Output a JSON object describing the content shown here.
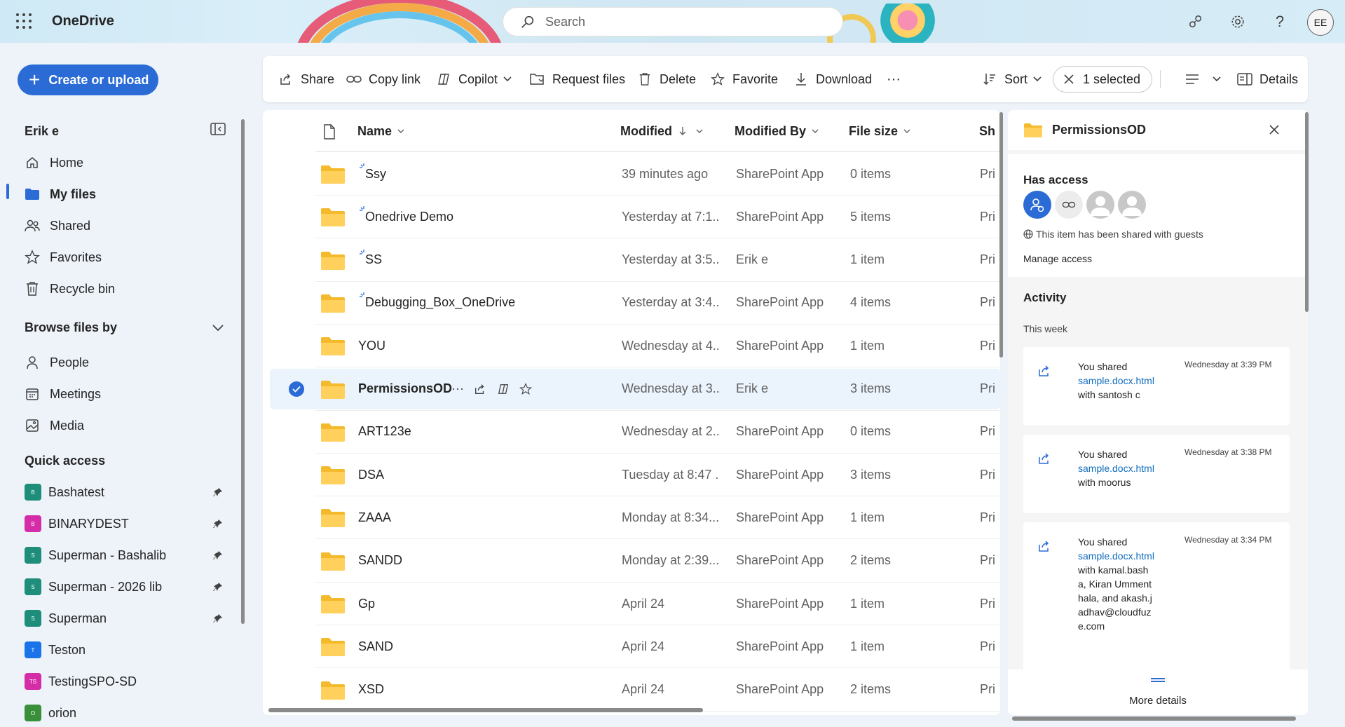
{
  "header": {
    "app_title": "OneDrive",
    "search_placeholder": "Search",
    "avatar_initials": "EE"
  },
  "nav": {
    "create_label": "Create or upload",
    "user_name": "Erik e",
    "items": [
      {
        "label": "Home",
        "icon": "home-icon"
      },
      {
        "label": "My files",
        "icon": "folder-icon"
      },
      {
        "label": "Shared",
        "icon": "people-icon"
      },
      {
        "label": "Favorites",
        "icon": "star-icon"
      },
      {
        "label": "Recycle bin",
        "icon": "trash-icon"
      }
    ],
    "browse_title": "Browse files by",
    "browse_items": [
      {
        "label": "People",
        "icon": "person-icon"
      },
      {
        "label": "Meetings",
        "icon": "calendar-icon"
      },
      {
        "label": "Media",
        "icon": "image-icon"
      }
    ],
    "quick_title": "Quick access",
    "quick_items": [
      {
        "label": "Bashatest",
        "badge": "B",
        "color": "#1e8e7a",
        "pinned": true
      },
      {
        "label": "BINARYDEST",
        "badge": "B",
        "color": "#d52ca8",
        "pinned": true
      },
      {
        "label": "Superman - Bashalib",
        "badge": "S",
        "color": "#1e8e7a",
        "pinned": true
      },
      {
        "label": "Superman - 2026 lib",
        "badge": "S",
        "color": "#1e8e7a",
        "pinned": true
      },
      {
        "label": "Superman",
        "badge": "S",
        "color": "#1e8e7a",
        "pinned": true
      },
      {
        "label": "Teston",
        "badge": "T",
        "color": "#1a73e8",
        "pinned": false
      },
      {
        "label": "TestingSPO-SD",
        "badge": "TS",
        "color": "#d52ca8",
        "pinned": false
      },
      {
        "label": "orion",
        "badge": "O",
        "color": "#3a8f3a",
        "pinned": false
      }
    ]
  },
  "commands": {
    "share": "Share",
    "copy_link": "Copy link",
    "copilot": "Copilot",
    "request_files": "Request files",
    "delete": "Delete",
    "favorite": "Favorite",
    "download": "Download",
    "more": "···",
    "sort": "Sort",
    "selected": "1 selected",
    "details": "Details"
  },
  "columns": {
    "name": "Name",
    "modified": "Modified",
    "modified_by": "Modified By",
    "file_size": "File size",
    "sharing": "Sh"
  },
  "rows": [
    {
      "name": "Ssy",
      "modified": "39 minutes ago",
      "by": "SharePoint App",
      "size": "0 items",
      "sh": "Pri",
      "new": true
    },
    {
      "name": "Onedrive Demo",
      "modified": "Yesterday at 7:1...",
      "by": "SharePoint App",
      "size": "5 items",
      "sh": "Pri",
      "new": true
    },
    {
      "name": "SS",
      "modified": "Yesterday at 3:5...",
      "by": "Erik e",
      "size": "1 item",
      "sh": "Pri",
      "new": true
    },
    {
      "name": "Debugging_Box_OneDrive",
      "modified": "Yesterday at 3:4...",
      "by": "SharePoint App",
      "size": "4 items",
      "sh": "Pri",
      "new": true
    },
    {
      "name": "YOU",
      "modified": "Wednesday at 4...",
      "by": "SharePoint App",
      "size": "1 item",
      "sh": "Pri",
      "new": false
    },
    {
      "name": "PermissionsOD",
      "modified": "Wednesday at 3...",
      "by": "Erik e",
      "size": "3 items",
      "sh": "Pri",
      "new": false,
      "selected": true
    },
    {
      "name": "ART123e",
      "modified": "Wednesday at 2...",
      "by": "SharePoint App",
      "size": "0 items",
      "sh": "Pri",
      "new": false
    },
    {
      "name": "DSA",
      "modified": "Tuesday at 8:47 ...",
      "by": "SharePoint App",
      "size": "3 items",
      "sh": "Pri",
      "new": false
    },
    {
      "name": "ZAAA",
      "modified": "Monday at 8:34...",
      "by": "SharePoint App",
      "size": "1 item",
      "sh": "Pri",
      "new": false
    },
    {
      "name": "SANDD",
      "modified": "Monday at 2:39...",
      "by": "SharePoint App",
      "size": "2 items",
      "sh": "Pri",
      "new": false
    },
    {
      "name": "Gp",
      "modified": "April 24",
      "by": "SharePoint App",
      "size": "1 item",
      "sh": "Pri",
      "new": false
    },
    {
      "name": "SAND",
      "modified": "April 24",
      "by": "SharePoint App",
      "size": "1 item",
      "sh": "Pri",
      "new": false
    },
    {
      "name": "XSD",
      "modified": "April 24",
      "by": "SharePoint App",
      "size": "2 items",
      "sh": "Pri",
      "new": false
    }
  ],
  "details": {
    "title": "PermissionsOD",
    "has_access": "Has access",
    "guest_note": "This item has been shared with guests",
    "manage_access": "Manage access",
    "activity": "Activity",
    "this_week": "This week",
    "activities": [
      {
        "prefix": "You shared",
        "file": "sample.docx.html",
        "suffix": "with santosh c",
        "time": "Wednesday at 3:39 PM"
      },
      {
        "prefix": "You shared",
        "file": "sample.docx.html",
        "suffix": "with moorus",
        "time": "Wednesday at 3:38 PM"
      },
      {
        "prefix": "You shared",
        "file": "sample.docx.html",
        "suffix": "with kamal.basha, Kiran Ummenthala, and akash.jadhav@cloudfuze.com",
        "time": "Wednesday at 3:34 PM"
      }
    ],
    "more_details": "More details"
  }
}
